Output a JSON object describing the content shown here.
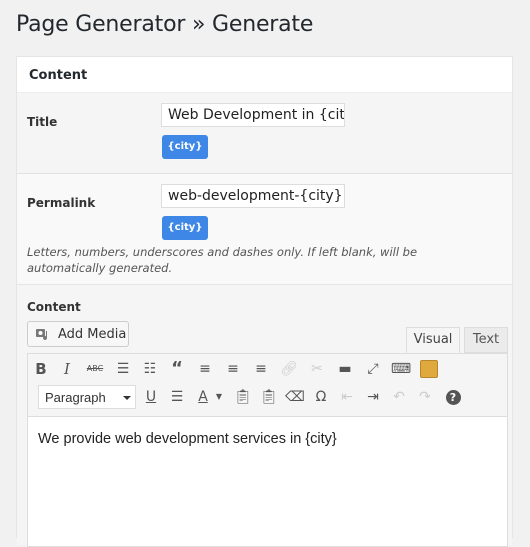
{
  "page": {
    "title": "Page Generator » Generate"
  },
  "postbox": {
    "heading": "Content"
  },
  "title_field": {
    "label": "Title",
    "value": "Web Development in {city}",
    "keyword_button": "{city}"
  },
  "permalink_field": {
    "label": "Permalink",
    "value": "web-development-{city}",
    "keyword_button": "{city}",
    "help": "Letters, numbers, underscores and dashes only. If left blank, will be automatically generated."
  },
  "content_field": {
    "label": "Content",
    "add_media": "Add Media",
    "tabs": [
      {
        "label": "Visual",
        "active": true
      },
      {
        "label": "Text",
        "active": false
      }
    ],
    "format_select": "Paragraph",
    "body": "We provide web development services in {city}"
  },
  "colors": {
    "accent": "#3f87e6",
    "background": "#f1f1f1"
  }
}
